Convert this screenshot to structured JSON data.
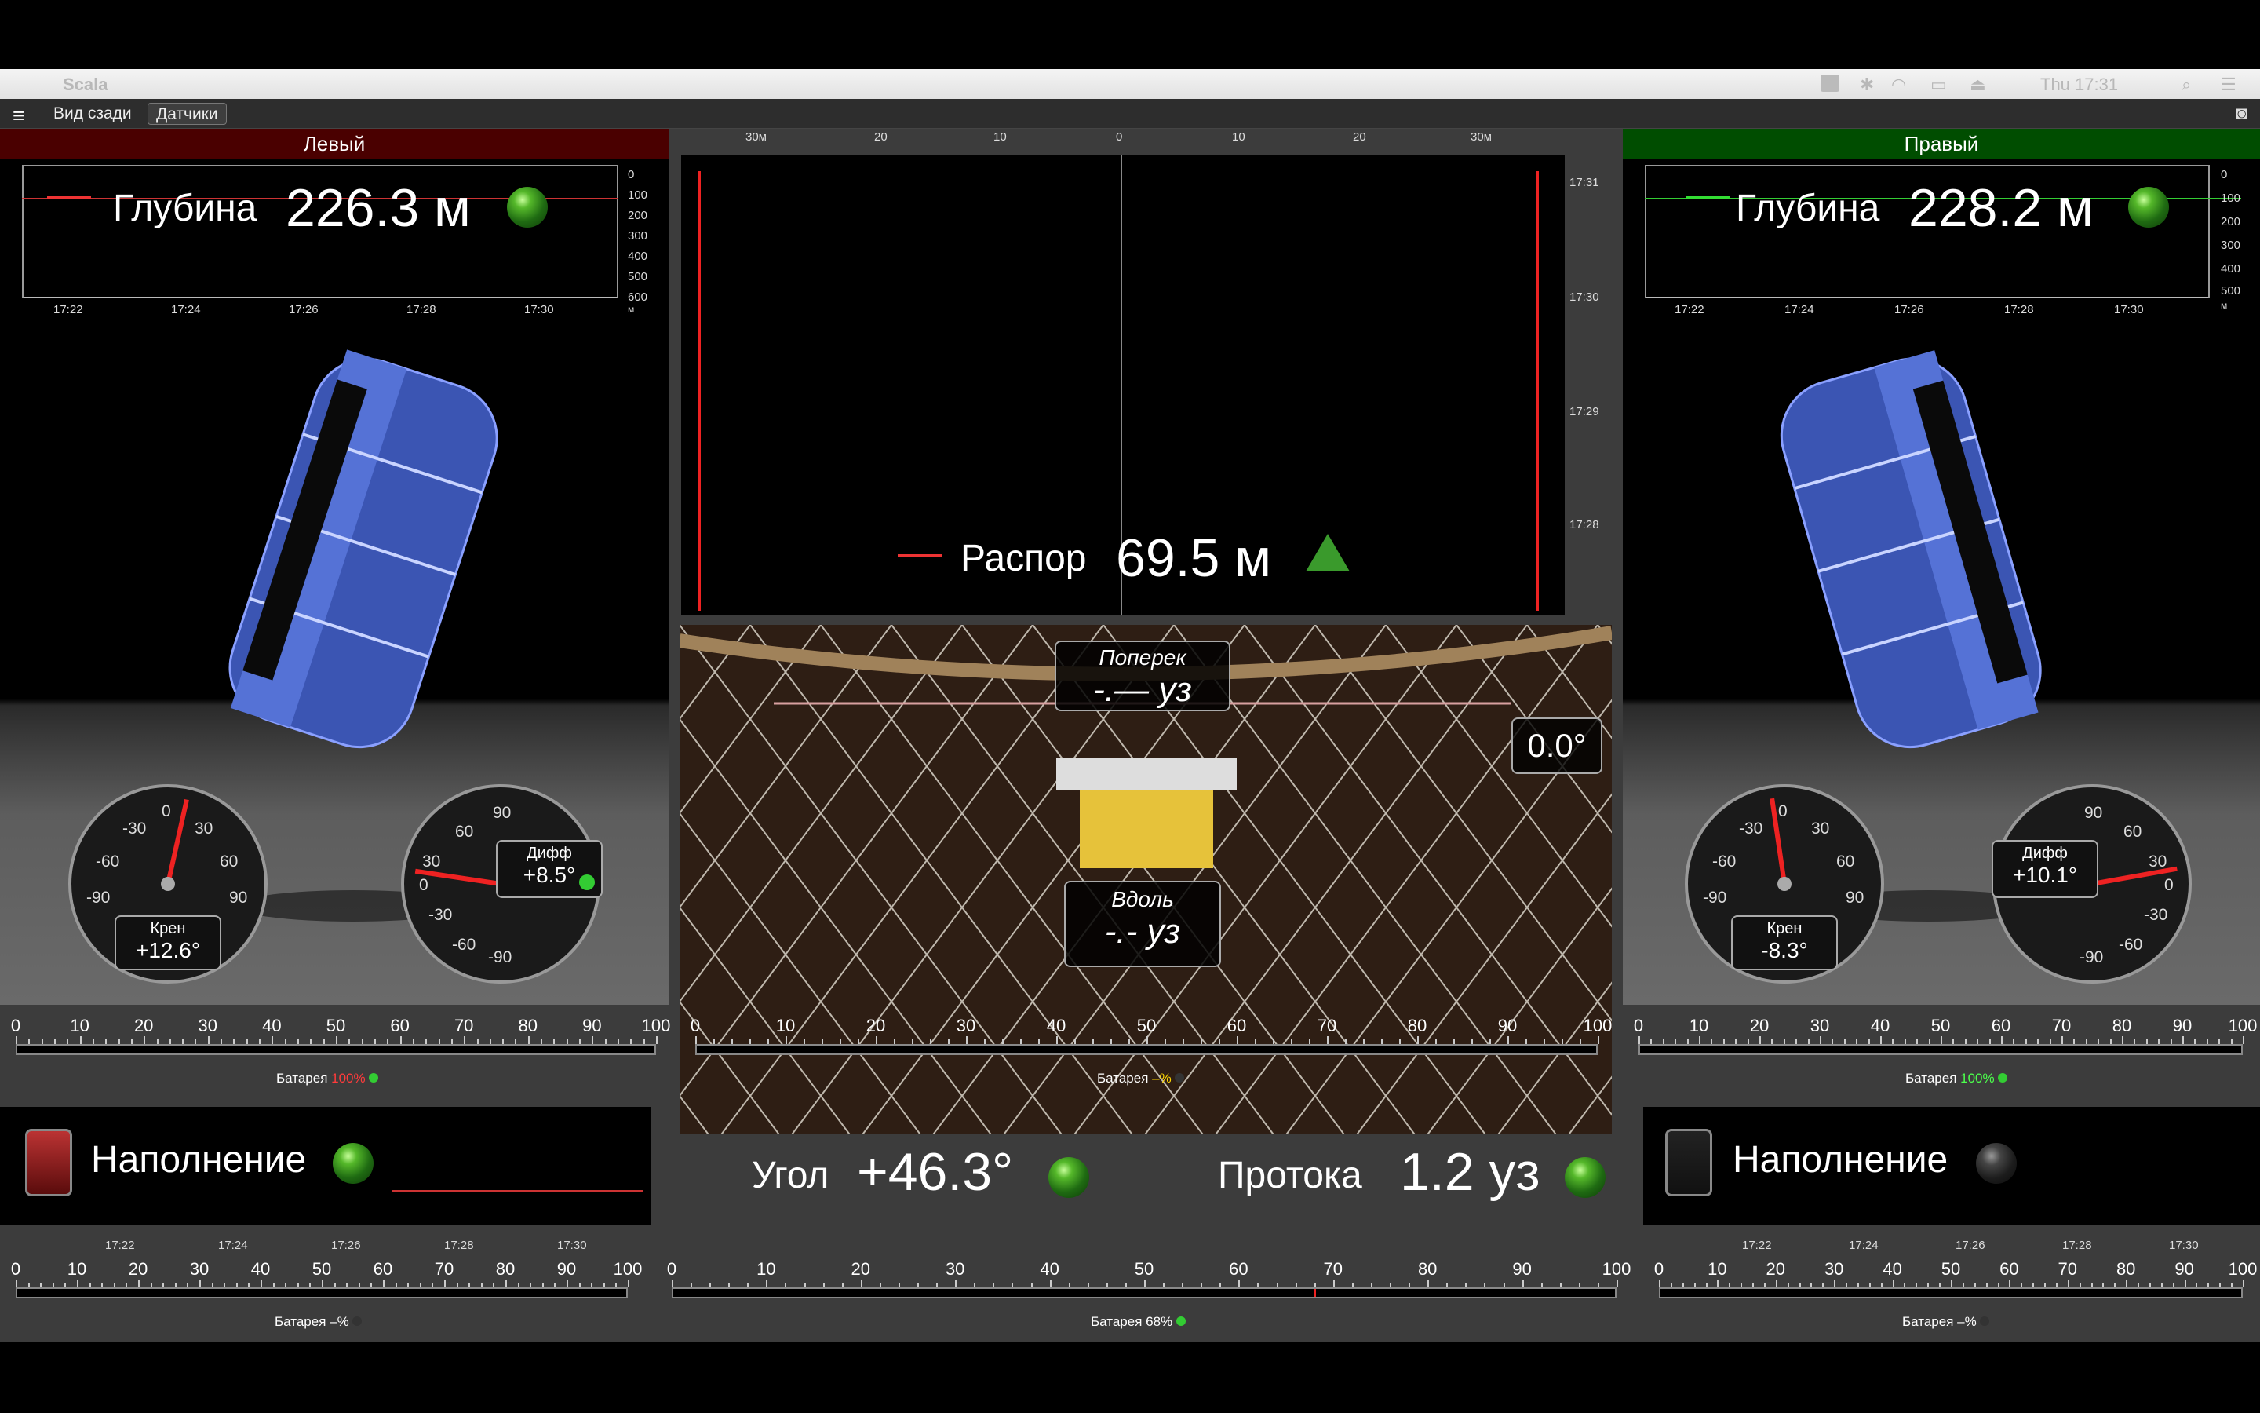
{
  "menubar": {
    "app_name": "Scala",
    "clock": "Thu 17:31"
  },
  "toolbar": {
    "tab_rear": "Вид сзади",
    "tab_sensors": "Датчики"
  },
  "left": {
    "header": "Левый",
    "depth_label": "Глубина",
    "depth_value": "226.3 м",
    "y_ticks": [
      "0",
      "100",
      "200",
      "300",
      "400",
      "500",
      "600",
      "м"
    ],
    "time_ticks": [
      "17:22",
      "17:24",
      "17:26",
      "17:28",
      "17:30"
    ],
    "roll_label": "Крен",
    "roll_value": "+12.6°",
    "roll_angle": 12.6,
    "diff_label": "Дифф",
    "diff_value": "+8.5°",
    "diff_angle": 8.5,
    "gauge_ticks_roll": [
      "-30",
      "0",
      "30",
      "-60",
      "60",
      "-90",
      "90"
    ],
    "gauge_ticks_diff": [
      "90",
      "60",
      "30",
      "0",
      "-30",
      "-60",
      "-90"
    ],
    "battery_label": "Батарея",
    "battery_value": "100%",
    "battery_color": "#ff3b3b",
    "fill_label": "Наполнение",
    "fill_times": [
      "17:22",
      "17:24",
      "17:26",
      "17:28",
      "17:30"
    ],
    "bottom_battery_label": "Батарея",
    "bottom_battery_value": "–%"
  },
  "right": {
    "header": "Правый",
    "depth_label": "Глубина",
    "depth_value": "228.2 м",
    "y_ticks": [
      "0",
      "100",
      "200",
      "300",
      "400",
      "500",
      "м"
    ],
    "time_ticks": [
      "17:22",
      "17:24",
      "17:26",
      "17:28",
      "17:30"
    ],
    "roll_label": "Крен",
    "roll_value": "-8.3°",
    "roll_angle": -8.3,
    "diff_label": "Дифф",
    "diff_value": "+10.1°",
    "diff_angle": 10.1,
    "gauge_ticks_roll": [
      "-30",
      "0",
      "30",
      "-60",
      "60",
      "-90",
      "90"
    ],
    "gauge_ticks_diff": [
      "90",
      "60",
      "30",
      "0",
      "-30",
      "-60",
      "-90"
    ],
    "battery_label": "Батарея",
    "battery_value": "100%",
    "battery_color": "#4cff4c",
    "fill_label": "Наполнение",
    "fill_times": [
      "17:22",
      "17:24",
      "17:26",
      "17:28",
      "17:30"
    ],
    "bottom_battery_label": "Батарея",
    "bottom_battery_value": "–%"
  },
  "center": {
    "x_ticks": [
      "30м",
      "20",
      "10",
      "0",
      "10",
      "20",
      "30м"
    ],
    "time_ticks": [
      "17:31",
      "17:30",
      "17:29",
      "17:28"
    ],
    "spread_label": "Распор",
    "spread_value": "69.5 м",
    "cross_label": "Поперек",
    "cross_value": "-.— уз",
    "along_label": "Вдоль",
    "along_value": "-.- уз",
    "angle_readout": "0.0°",
    "battery_label": "Батарея",
    "battery_value": "–%",
    "angle_label": "Угол",
    "angle_value": "+46.3°",
    "flow_label": "Протока",
    "flow_value": "1.2 уз",
    "bottom_battery_label": "Батарея",
    "bottom_battery_value": "68%",
    "bottom_level": 68
  },
  "ruler_ticks": [
    "0",
    "10",
    "20",
    "30",
    "40",
    "50",
    "60",
    "70",
    "80",
    "90",
    "100"
  ]
}
